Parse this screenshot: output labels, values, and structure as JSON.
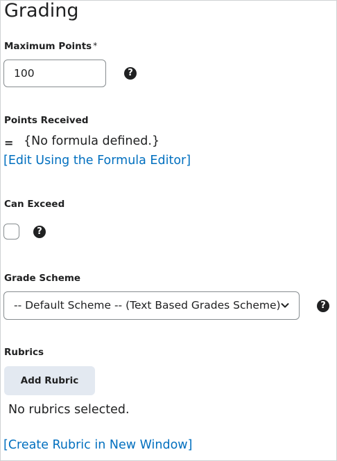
{
  "page": {
    "title": "Grading"
  },
  "max_points": {
    "label": "Maximum Points",
    "required_mark": "*",
    "value": "100"
  },
  "points_received": {
    "label": "Points Received",
    "equals": "=",
    "formula_text": "{No formula defined.}",
    "edit_link": "[Edit Using the Formula Editor]"
  },
  "can_exceed": {
    "label": "Can Exceed",
    "checked": false
  },
  "grade_scheme": {
    "label": "Grade Scheme",
    "selected": "-- Default Scheme -- (Text Based Grades Scheme)"
  },
  "rubrics": {
    "label": "Rubrics",
    "add_button": "Add Rubric",
    "empty_text": "No rubrics selected.",
    "create_link": "[Create Rubric in New Window]"
  },
  "help_icon_glyph": "?",
  "colors": {
    "link": "#006fbf",
    "button_bg": "#e3e9f1",
    "text": "#202122"
  }
}
